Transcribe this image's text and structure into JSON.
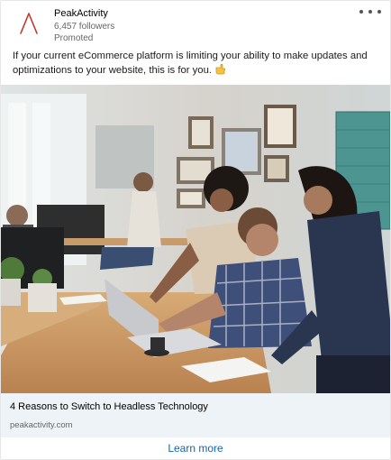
{
  "post": {
    "company_name": "PeakActivity",
    "followers": "6,457 followers",
    "promoted": "Promoted",
    "body": "If your current eCommerce platform is limiting your ability to make updates and optimizations to your website, this is for you.",
    "emoji_icon": "pointing-hand-icon"
  },
  "ad": {
    "headline": "4 Reasons to Switch to Headless Technology",
    "domain": "peakactivity.com",
    "cta_label": "Learn more"
  },
  "colors": {
    "brand_logo": "#c0392b",
    "cta": "#0a66c2",
    "footer_bg": "#eef3f8"
  }
}
